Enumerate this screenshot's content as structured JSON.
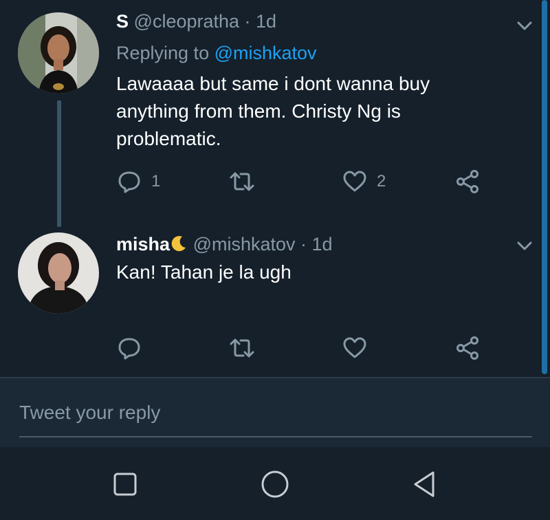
{
  "tweets": [
    {
      "display_name": "S",
      "handle": "@cleopratha",
      "time": "· 1d",
      "replying_label": "Replying to",
      "replying_handle": "@mishkatov",
      "text": "Lawaaaa but same i dont wanna buy anything from them. Christy Ng is problematic.",
      "replies": "1",
      "retweets": "",
      "likes": "2"
    },
    {
      "display_name": "misha",
      "display_emoji": "crescent-moon-icon",
      "handle": "@mishkatov",
      "time": "· 1d",
      "text": "Kan! Tahan je la ugh",
      "replies": "",
      "retweets": "",
      "likes": ""
    }
  ],
  "composer": {
    "placeholder": "Tweet your reply"
  },
  "colors": {
    "background": "#15202b",
    "link": "#1da1f2",
    "muted": "#8899a6",
    "composer_bg": "#1b2836"
  },
  "navigation": {
    "buttons": [
      "recent-apps-icon",
      "home-icon",
      "back-icon"
    ]
  }
}
